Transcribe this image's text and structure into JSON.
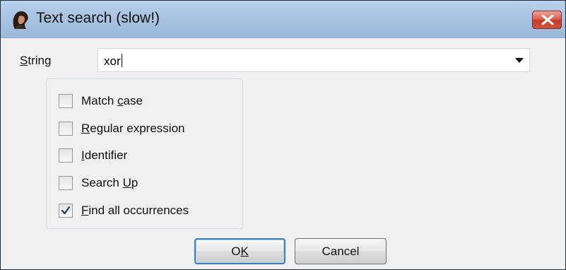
{
  "window": {
    "title": "Text search (slow!)",
    "app_icon": "ida-pro-icon",
    "close_icon": "close-icon"
  },
  "search": {
    "label_mnemonic": "S",
    "label_rest": "tring",
    "value": "xor"
  },
  "options": [
    {
      "pre": "Match ",
      "mnemonic": "c",
      "post": "ase",
      "checked": false
    },
    {
      "pre": "",
      "mnemonic": "R",
      "post": "egular expression",
      "checked": false
    },
    {
      "pre": "",
      "mnemonic": "I",
      "post": "dentifier",
      "checked": false
    },
    {
      "pre": "Search ",
      "mnemonic": "U",
      "post": "p",
      "checked": false
    },
    {
      "pre": "",
      "mnemonic": "F",
      "post": "ind all occurrences",
      "checked": true
    }
  ],
  "buttons": {
    "ok_pre": "O",
    "ok_mnemonic": "K",
    "cancel": "Cancel"
  },
  "colors": {
    "titlebar": "#a9c4e2",
    "close_button": "#d9624f",
    "default_button_border": "#3c7fb1"
  }
}
